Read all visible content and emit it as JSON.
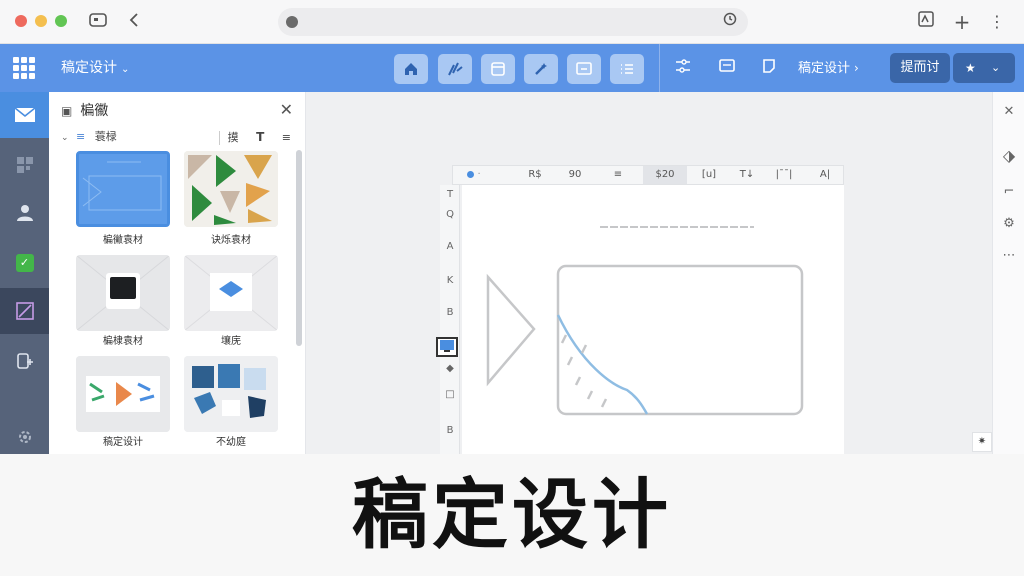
{
  "browser": {
    "tab_icon": "window-icon",
    "back_icon": "back-arrow-icon",
    "address_value": "",
    "right_icons": [
      "reader-icon",
      "new-tab-plus-icon",
      "more-vertical-icon"
    ]
  },
  "app": {
    "project_title": "稿定设计",
    "toolbar_tools": [
      "home-icon",
      "ai-sparkle-icon",
      "template-icon",
      "magic-wand-icon",
      "present-icon",
      "list-icon"
    ],
    "right_icons": [
      "filter-icon",
      "comment-icon",
      "page-icon"
    ],
    "breadcrumb": "稿定设计",
    "action_button": "提而讨",
    "star_button_icon": "star-icon"
  },
  "rail": {
    "items": [
      "mail-icon",
      "grid-widgets-icon",
      "people-icon",
      "check-icon",
      "image-edit-icon",
      "user-add-icon",
      "settings-icon"
    ]
  },
  "panel": {
    "title": "楄鰴",
    "filter_label": "蓑椂",
    "filter_right": [
      "摸",
      "T",
      "≡"
    ],
    "thumbs": [
      {
        "label": "楄鰴袁材",
        "selected": true
      },
      {
        "label": "诀烁袁材",
        "selected": false
      },
      {
        "label": "楄棣袁材",
        "selected": false
      },
      {
        "label": "壤庑",
        "selected": false
      },
      {
        "label": "稿定设计",
        "selected": false
      },
      {
        "label": "不幼庭",
        "selected": false
      }
    ]
  },
  "canvas": {
    "htoolbar": [
      "R$",
      "90",
      "≡",
      "$20",
      "[u]",
      "T↓",
      "|¯¯|",
      "A|"
    ],
    "vtoolbar": [
      "T",
      "Q",
      "A",
      "K",
      "B",
      "▣",
      "◆",
      "□",
      "B"
    ]
  },
  "caption": {
    "text": "稿定设计"
  }
}
